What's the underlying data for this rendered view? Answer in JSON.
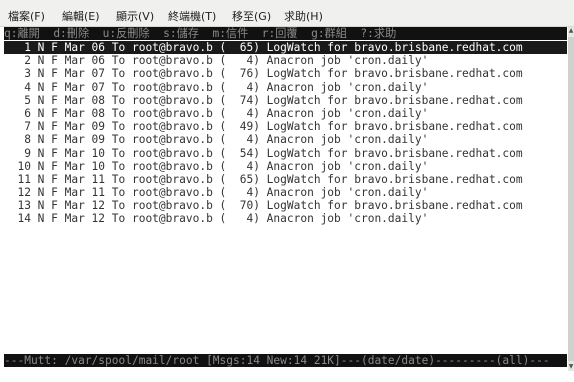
{
  "menubar": {
    "items": [
      "檔案(F)",
      "編輯(E)",
      "顯示(V)",
      "終端機(T)",
      "移至(G)",
      "求助(H)"
    ]
  },
  "helpbar": "q:離開  d:刪除  u:反刪除  s:儲存  m:信件  r:回覆  g:群組  ?:求助",
  "messages": [
    "   1 N F Mar 06 To root@bravo.b (  65) LogWatch for bravo.brisbane.redhat.com",
    "   2 N F Mar 06 To root@bravo.b (   4) Anacron job 'cron.daily'",
    "   3 N F Mar 07 To root@bravo.b (  76) LogWatch for bravo.brisbane.redhat.com",
    "   4 N F Mar 07 To root@bravo.b (   4) Anacron job 'cron.daily'",
    "   5 N F Mar 08 To root@bravo.b (  74) LogWatch for bravo.brisbane.redhat.com",
    "   6 N F Mar 08 To root@bravo.b (   4) Anacron job 'cron.daily'",
    "   7 N F Mar 09 To root@bravo.b (  49) LogWatch for bravo.brisbane.redhat.com",
    "   8 N F Mar 09 To root@bravo.b (   4) Anacron job 'cron.daily'",
    "   9 N F Mar 10 To root@bravo.b (  54) LogWatch for bravo.brisbane.redhat.com",
    "  10 N F Mar 10 To root@bravo.b (   4) Anacron job 'cron.daily'",
    "  11 N F Mar 11 To root@bravo.b (  65) LogWatch for bravo.brisbane.redhat.com",
    "  12 N F Mar 11 To root@bravo.b (   4) Anacron job 'cron.daily'",
    "  13 N F Mar 12 To root@bravo.b (  70) LogWatch for bravo.brisbane.redhat.com",
    "  14 N F Mar 12 To root@bravo.b (   4) Anacron job 'cron.daily'"
  ],
  "selected_index": 0,
  "statusbar": "---Mutt: /var/spool/mail/root [Msgs:14 New:14 21K]---(date/date)---------(all)---",
  "colors": {
    "terminal_bg": "#ffffff",
    "bar_bg": "#111111",
    "bar_fg": "#8a8a8a",
    "selected_bg": "#1a1a1a",
    "selected_fg": "#ffffff"
  }
}
